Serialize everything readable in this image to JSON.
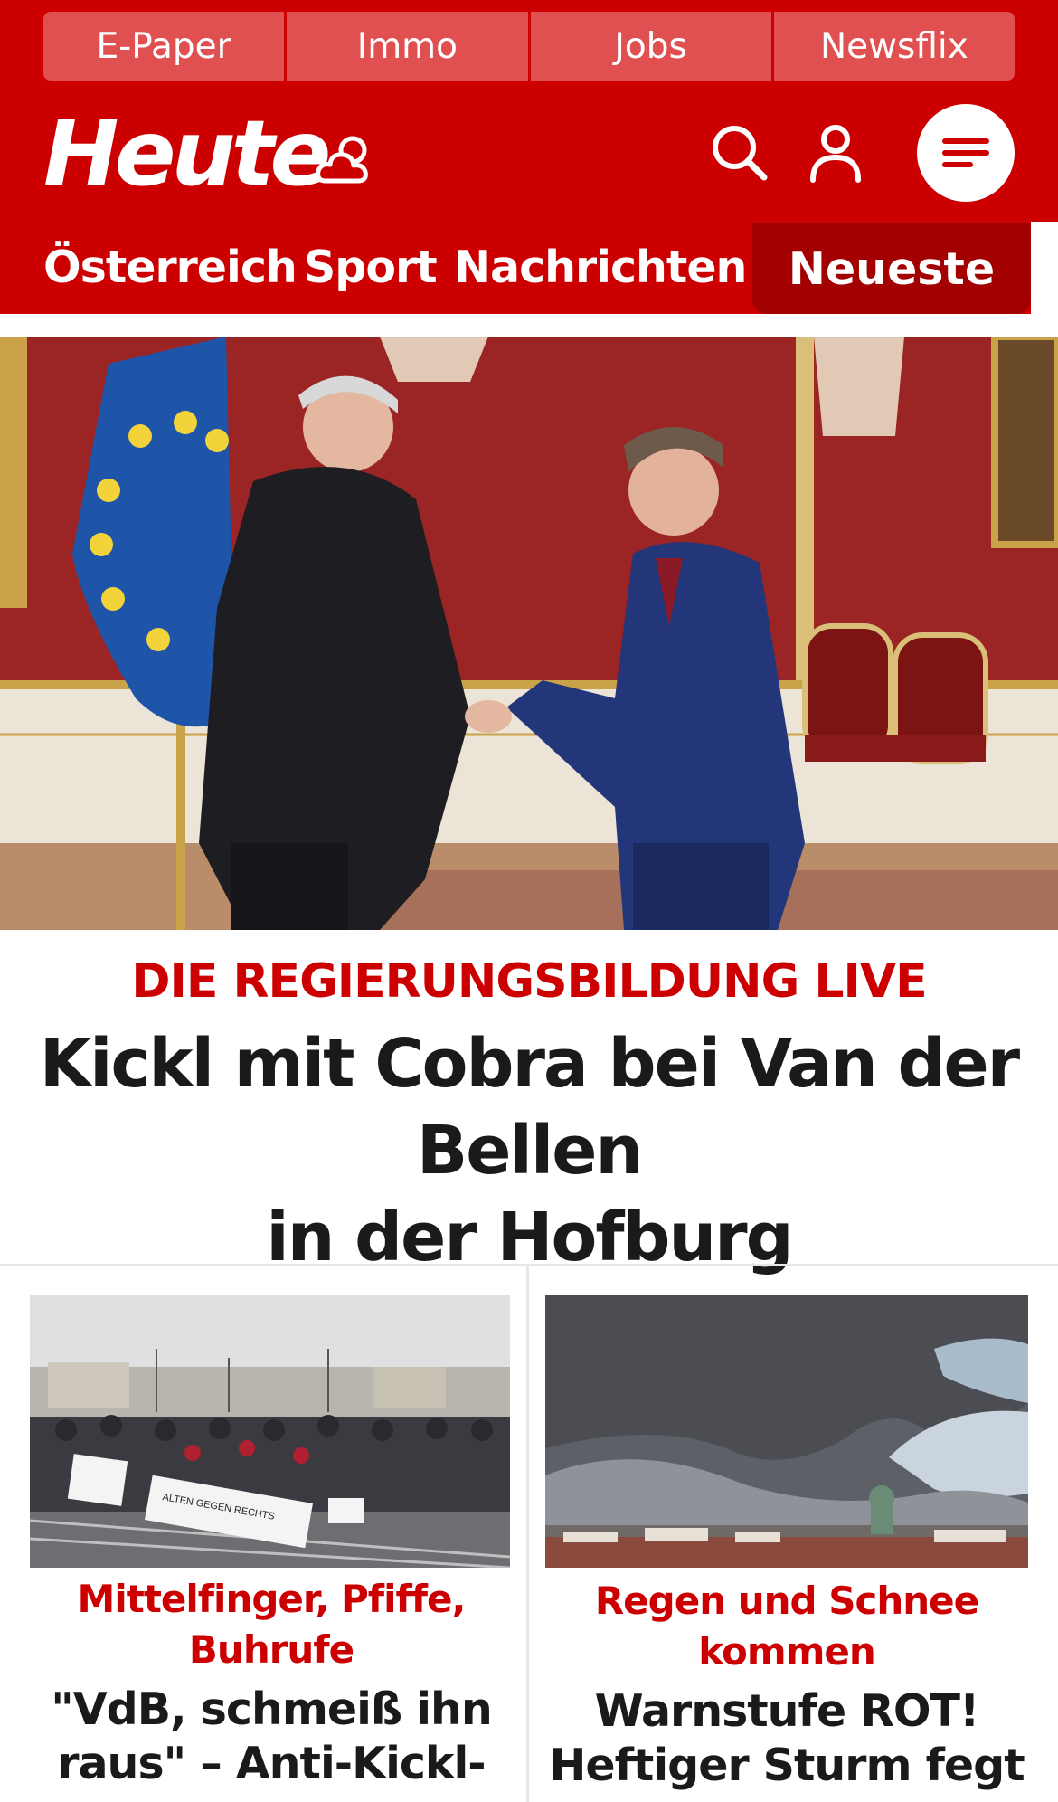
{
  "header": {
    "subnav": [
      "E-Paper",
      "Immo",
      "Jobs",
      "Newsflix"
    ],
    "logo": "Heute",
    "colors": {
      "brand_red": "#cc0001",
      "dark_red": "#a30001"
    }
  },
  "categories": {
    "items": [
      "Österreich",
      "Sport",
      "Nachrichten"
    ],
    "active": "Neueste"
  },
  "hero": {
    "kicker": "DIE REGIERUNGSBILDUNG LIVE",
    "headline_line1": "Kickl mit Cobra bei Van der Bellen",
    "headline_line2": "in der Hofburg"
  },
  "teasers": [
    {
      "kicker_line1": "Mittelfinger, Pfiffe,",
      "kicker_line2": "Buhrufe",
      "title_line1": "\"VdB, schmeiß ihn",
      "title_line2": "raus\" – Anti-Kickl-",
      "image_banner": "ALTEN GEGEN RECHTS"
    },
    {
      "kicker_line1": "Regen und Schnee",
      "kicker_line2": "kommen",
      "title_line1": "Warnstufe ROT!",
      "title_line2": "Heftiger Sturm fegt"
    }
  ],
  "icons": [
    "weather-cloud-icon",
    "search-icon",
    "user-icon",
    "menu-icon"
  ]
}
